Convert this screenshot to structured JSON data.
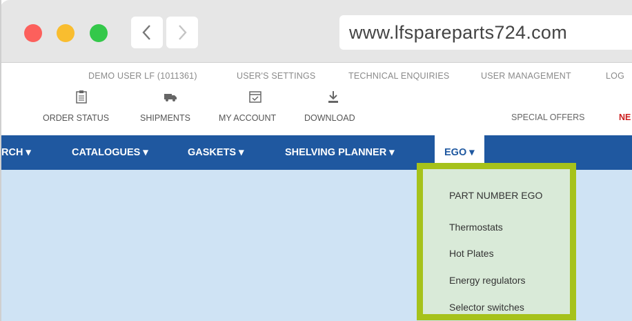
{
  "browser": {
    "url": "www.lfspareparts724.com"
  },
  "topbar": {
    "user": "DEMO USER LF (1011361)",
    "settings": "USER'S SETTINGS",
    "enquiries": "TECHNICAL ENQUIRIES",
    "management": "USER MANAGEMENT",
    "logout": "LOG"
  },
  "icons": {
    "order_status": "ORDER STATUS",
    "shipments": "SHIPMENTS",
    "my_account": "MY ACCOUNT",
    "download": "DOWNLOAD",
    "special_offers": "SPECIAL OFFERS",
    "new": "NE"
  },
  "nav": {
    "search": "RCH",
    "catalogues": "CATALOGUES",
    "gaskets": "GASKETS",
    "shelving": "SHELVING PLANNER",
    "ego": "EGO"
  },
  "ego_menu": {
    "items": [
      "PART NUMBER EGO",
      "Thermostats",
      "Hot Plates",
      "Energy regulators",
      "Selector switches"
    ]
  },
  "colors": {
    "nav_bg": "#1f58a0",
    "content_bg": "#cfe3f4",
    "highlight_border": "#a6c21b",
    "dropdown_bg": "#d9ead8"
  }
}
